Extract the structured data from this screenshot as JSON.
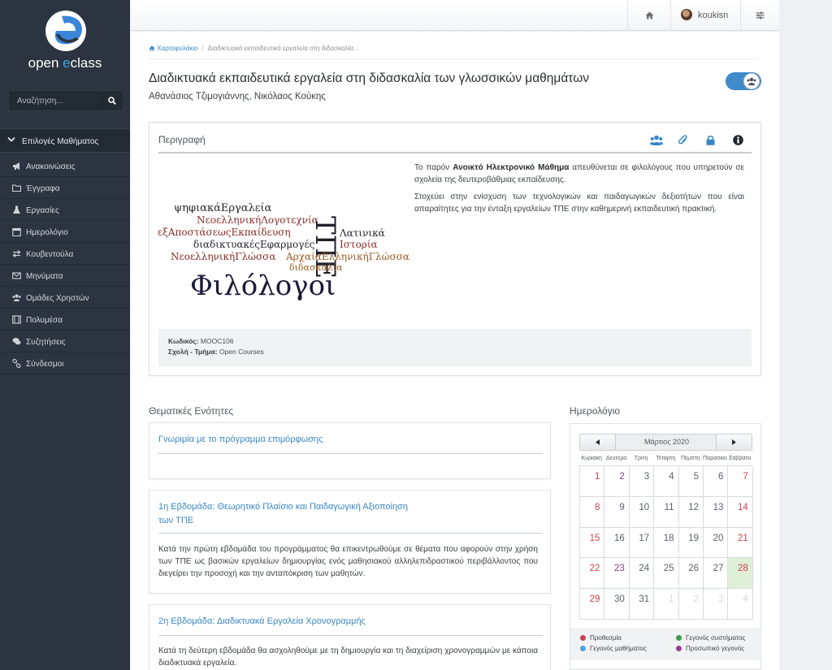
{
  "sidebar": {
    "logo_text_open": "open",
    "logo_text_e": "e",
    "logo_text_class": "class",
    "search_placeholder": "Αναζήτηση...",
    "course_options_label": "Επιλογές Μαθήματος",
    "nav_items": [
      {
        "label": "Ανακοινώσεις",
        "icon": "bullhorn-icon"
      },
      {
        "label": "Έγγραφα",
        "icon": "folder-icon"
      },
      {
        "label": "Εργασίες",
        "icon": "flask-icon"
      },
      {
        "label": "Ημερολόγιο",
        "icon": "calendar-icon"
      },
      {
        "label": "Κουβεντούλα",
        "icon": "exchange-icon"
      },
      {
        "label": "Μηνύματα",
        "icon": "envelope-icon"
      },
      {
        "label": "Ομάδες Χρηστών",
        "icon": "users-icon"
      },
      {
        "label": "Πολυμέσα",
        "icon": "film-icon"
      },
      {
        "label": "Συζητήσεις",
        "icon": "comments-icon"
      },
      {
        "label": "Σύνδεσμοι",
        "icon": "link-icon"
      }
    ]
  },
  "topbar": {
    "username": "koukisn"
  },
  "breadcrumb": {
    "home": "Χαρτοφυλάκιο",
    "current": "Διαδικτυακά εκπαιδευτικά εργαλεία στη διδασκαλία..."
  },
  "course": {
    "title": "Διαδικτυακά εκπαιδευτικά εργαλεία στη διδασκαλία των γλωσσικών μαθημάτων",
    "authors": "Αθανάσιος Τζιμογιάννης, Νικόλαος Κούκης"
  },
  "description": {
    "heading": "Περιγραφή",
    "p1_pre": "Το παρόν ",
    "p1_bold": "Ανοικτό Ηλεκτρονικό Μάθημα",
    "p1_post": " απευθύνεται σε φιλολόγους που υπηρετούν σε σχολεία της δευτεροβάθμιας εκπαίδευσης.",
    "p2": "Στοχεύει στην ενίσχυση των τεχνολογικών και παιδαγωγικών δεξιοτήτων που είναι απαραίτητες για την ένταξη εργαλείων ΤΠΕ στην καθημερινή εκπαιδευτική πρακτική.",
    "code_label": "Κωδικός:",
    "code_value": "MOOC106",
    "school_label": "Σχολή - Τμήμα:",
    "school_value": "Open Courses",
    "word_cloud": {
      "w1": "ψηφιακάΕργαλεία",
      "w2": "ΝεοελληνικήΛογοτεχνία",
      "w3": "εξΑποστάσεωςΕκπαίδευση",
      "w4": "διαδικτυακέςΕφαρμογές",
      "w5": "ΝεοελληνικήΓλώσσα",
      "w6": "ΤΠΕ",
      "w7": "Λατινικά",
      "w8": "Ιστορία",
      "w9": "ΑρχαίαΕλληνικήΓλώσσα",
      "w10": "διδασκαλία",
      "w11": "Φιλόλογοι"
    }
  },
  "units": {
    "heading": "Θεματικές Ενότητες",
    "items": [
      {
        "title": "Γνωριμία με το πρόγραμμα επιμόρφωσης",
        "desc": ""
      },
      {
        "title_l1": "1η Εβδομάδα: Θεωρητικό Πλαίσιο και Παιδαγωγική Αξιοποίηση",
        "title_l2": "των ΤΠΕ",
        "desc": "Κατά την πρώτη εβδομάδα του προγράμματος θα επικεντρωθούμε σε θέματα που αφορούν στην χρήση των ΤΠΕ ως βασικών εργαλείων δημιουργίας ενός μαθησιακού αλληλεπιδραστικού περιβάλλοντος που διεγείρει την προσοχή και την ανταπόκριση των μαθητών."
      },
      {
        "title": "2η Εβδομάδα: Διαδικτυακά Εργαλεία Χρονογραμμής",
        "desc": "Κατά τη δεύτερη εβδομάδα θα ασχοληθούμε με τη δημιουργία και τη διαχείριση χρονογραμμών με κάποια διαδικτυακά εργαλεία."
      }
    ]
  },
  "calendar": {
    "heading": "Ημερολόγιο",
    "month": "Μάρτιος 2020",
    "weekdays": [
      "Κυριακή",
      "Δευτέρα",
      "Τρίτη",
      "Τετάρτη",
      "Πέμπτη",
      "Παρασκευή",
      "Σάββατο"
    ],
    "weeks": [
      [
        "1",
        "2",
        "3",
        "4",
        "5",
        "6",
        "7"
      ],
      [
        "8",
        "9",
        "10",
        "11",
        "12",
        "13",
        "14"
      ],
      [
        "15",
        "16",
        "17",
        "18",
        "19",
        "20",
        "21"
      ],
      [
        "22",
        "23",
        "24",
        "25",
        "26",
        "27",
        "28"
      ],
      [
        "29",
        "30",
        "31",
        "1",
        "2",
        "3",
        "4"
      ]
    ],
    "today": "28",
    "legend": {
      "deadline": "Προθεσμία",
      "course_event": "Γεγονός μαθήματος",
      "system_event": "Γεγονός συστήματος",
      "personal_event": "Προσωπικό γεγονός"
    },
    "colors": {
      "weekend": "#d0434b",
      "course_event": "#8b3c8a",
      "deadline": "#c9444c",
      "course_event_dot": "#4aa3e8",
      "system_event_dot": "#3a9a45",
      "personal_event_dot": "#9b3c9a"
    }
  }
}
